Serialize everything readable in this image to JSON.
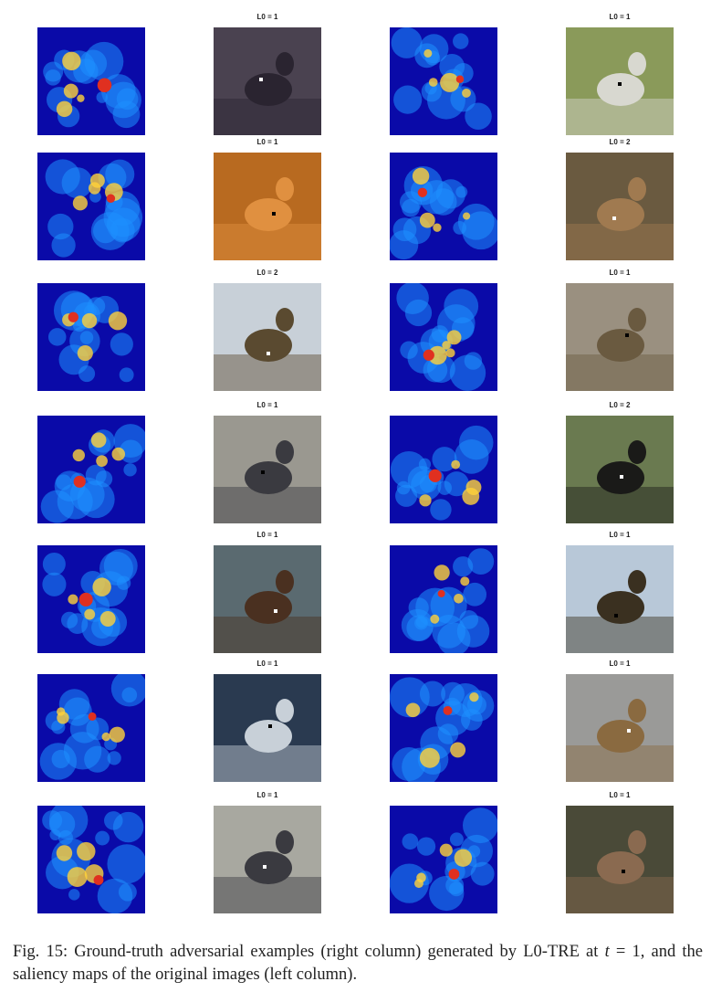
{
  "figure": {
    "rows": [
      {
        "left_label": "L0 = 1",
        "right_label": "L0 = 1"
      },
      {
        "left_label": "L0 = 1",
        "right_label": "L0 = 2"
      },
      {
        "left_label": "L0 = 2",
        "right_label": "L0 = 1"
      },
      {
        "left_label": "L0 = 1",
        "right_label": "L0 = 2"
      },
      {
        "left_label": "L0 = 1",
        "right_label": "L0 = 1"
      },
      {
        "left_label": "L0 = 1",
        "right_label": "L0 = 1"
      },
      {
        "left_label": "L0 = 1",
        "right_label": "L0 = 1"
      }
    ]
  },
  "caption": {
    "prefix": "Fig. 15: Ground-truth adversarial examples (right column) generated by L0-TRE at ",
    "var": "t",
    "eq": " = 1, and the saliency maps of the original images (left column)."
  },
  "colors": {
    "heat_bg": "#0a0aa8",
    "heat_mid": "#1e90ff",
    "heat_hot": "#e03020"
  }
}
